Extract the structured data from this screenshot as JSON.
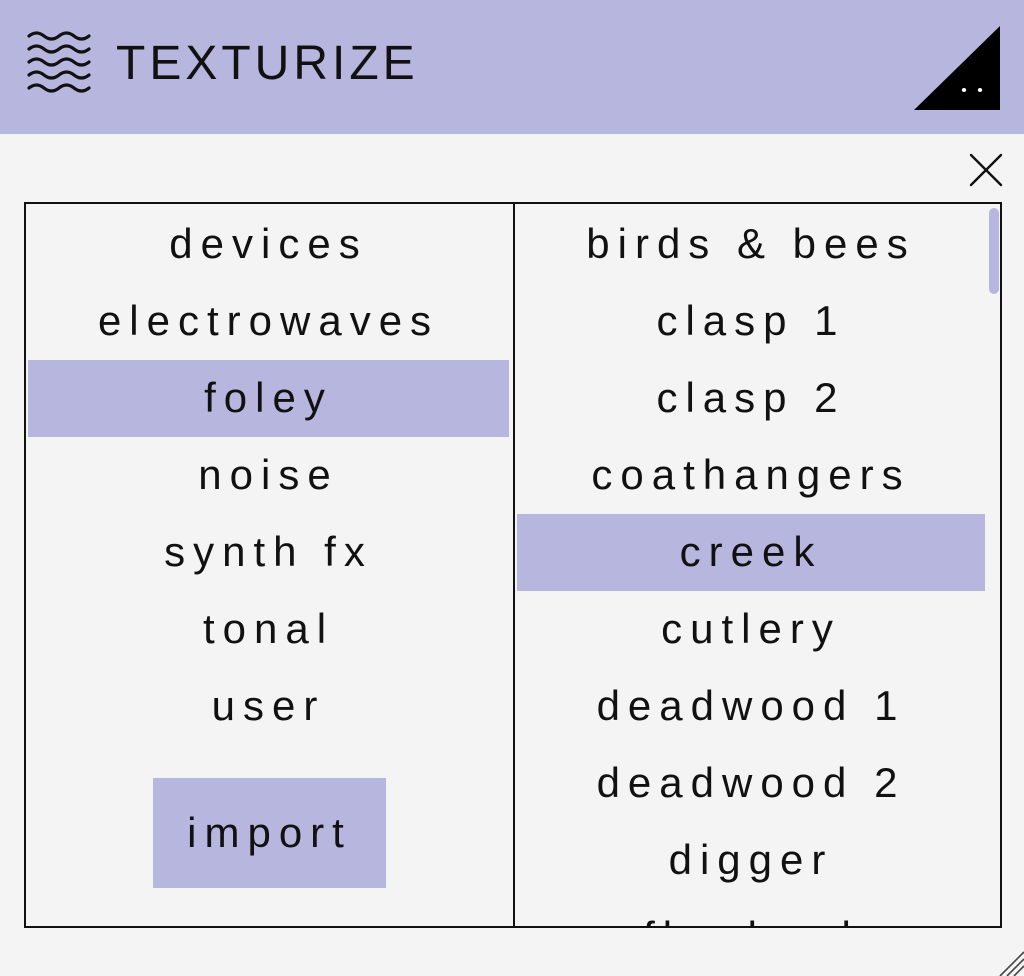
{
  "header": {
    "title": "TEXTURIZE",
    "logo_icon": "waves-icon",
    "corner_icon": "triangle-badge-icon",
    "accent_color": "#b6b6df"
  },
  "close_icon": "close-icon",
  "categories": {
    "items": [
      {
        "label": "devices",
        "selected": false
      },
      {
        "label": "electrowaves",
        "selected": false
      },
      {
        "label": "foley",
        "selected": true
      },
      {
        "label": "noise",
        "selected": false
      },
      {
        "label": "synth fx",
        "selected": false
      },
      {
        "label": "tonal",
        "selected": false
      },
      {
        "label": "user",
        "selected": false
      }
    ],
    "import_label": "import"
  },
  "presets": {
    "items": [
      {
        "label": "birds & bees",
        "selected": false
      },
      {
        "label": "clasp 1",
        "selected": false
      },
      {
        "label": "clasp 2",
        "selected": false
      },
      {
        "label": "coathangers",
        "selected": false
      },
      {
        "label": "creek",
        "selected": true
      },
      {
        "label": "cutlery",
        "selected": false
      },
      {
        "label": "deadwood 1",
        "selected": false
      },
      {
        "label": "deadwood 2",
        "selected": false
      },
      {
        "label": "digger",
        "selected": false
      },
      {
        "label": "flywheel",
        "selected": false
      }
    ]
  }
}
